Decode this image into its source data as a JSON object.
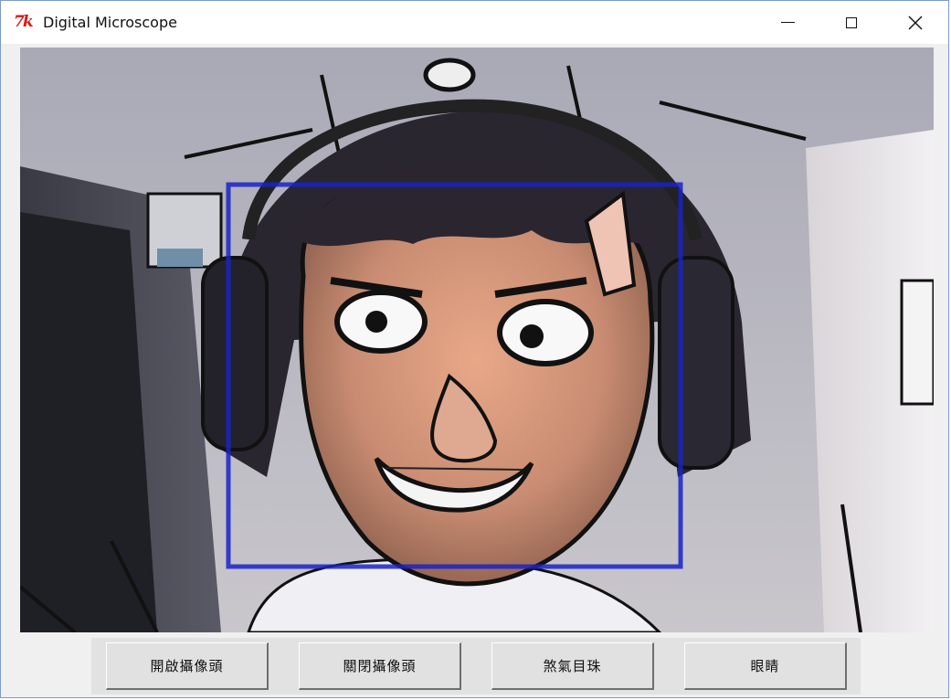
{
  "window": {
    "title": "Digital Microscope",
    "app_icon_glyph": "7k",
    "app_icon_name": "tk-feather-icon",
    "controls": {
      "minimize_icon": "minimize-icon",
      "maximize_icon": "maximize-icon",
      "close_icon": "close-icon",
      "close_glyph": "✕"
    }
  },
  "camera": {
    "content": "cartoonized webcam frame: person wearing headphones with exaggerated cartoon eyes, grin and a horn, blue face-detection box"
  },
  "buttons": [
    {
      "label": "開啟攝像頭"
    },
    {
      "label": "關閉攝像頭"
    },
    {
      "label": "煞氣目珠"
    },
    {
      "label": "眼睛"
    }
  ],
  "colors": {
    "tk_icon": "#d81818",
    "face_box": "#1a22c8",
    "title_bar": "#ffffff",
    "panel": "#e2e2e2"
  }
}
